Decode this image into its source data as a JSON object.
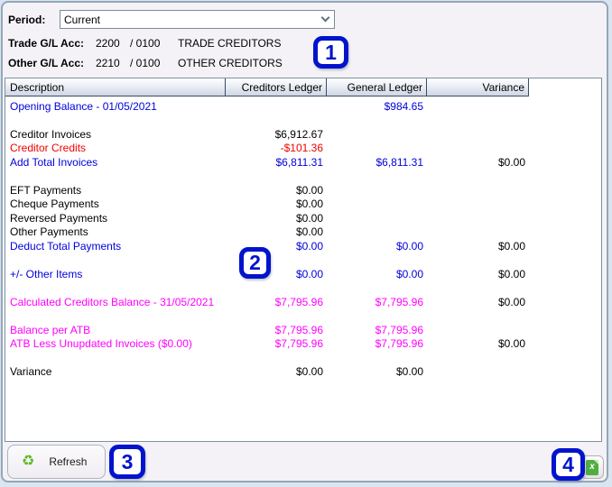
{
  "period": {
    "label": "Period:",
    "value": "Current"
  },
  "accounts": [
    {
      "label": "Trade G/L Acc:",
      "code": "2200",
      "sub": "/ 0100",
      "name": "TRADE CREDITORS"
    },
    {
      "label": "Other G/L Acc:",
      "code": "2210",
      "sub": "/ 0100",
      "name": "OTHER CREDITORS"
    }
  ],
  "table": {
    "columns": [
      "Description",
      "Creditors Ledger",
      "General Ledger",
      "Variance"
    ],
    "rows": [
      {
        "label": "Opening Balance - 01/05/2021",
        "color": "blue",
        "cl": "",
        "gl": "$984.65",
        "va": "",
        "gap": false
      },
      {
        "label": "Creditor Invoices",
        "color": "black",
        "cl": "$6,912.67",
        "gl": "",
        "va": "",
        "gap": true
      },
      {
        "label": "Creditor Credits",
        "color": "red",
        "cl": "-$101.36",
        "gl": "",
        "va": "",
        "gap": false
      },
      {
        "label": "Add Total Invoices",
        "color": "blue",
        "cl": "$6,811.31",
        "gl": "$6,811.31",
        "va": "$0.00",
        "gap": false
      },
      {
        "label": "EFT Payments",
        "color": "black",
        "cl": "$0.00",
        "gl": "",
        "va": "",
        "gap": true
      },
      {
        "label": "Cheque Payments",
        "color": "black",
        "cl": "$0.00",
        "gl": "",
        "va": "",
        "gap": false
      },
      {
        "label": "Reversed Payments",
        "color": "black",
        "cl": "$0.00",
        "gl": "",
        "va": "",
        "gap": false
      },
      {
        "label": "Other Payments",
        "color": "black",
        "cl": "$0.00",
        "gl": "",
        "va": "",
        "gap": false
      },
      {
        "label": "Deduct Total Payments",
        "color": "blue",
        "cl": "$0.00",
        "gl": "$0.00",
        "va": "$0.00",
        "gap": false
      },
      {
        "label": "+/- Other Items",
        "color": "blue",
        "cl": "$0.00",
        "gl": "$0.00",
        "va": "$0.00",
        "gap": true
      },
      {
        "label": "Calculated Creditors Balance - 31/05/2021",
        "color": "magenta",
        "cl": "$7,795.96",
        "gl": "$7,795.96",
        "va": "$0.00",
        "gap": true
      },
      {
        "label": "Balance per ATB",
        "color": "magenta",
        "cl": "$7,795.96",
        "gl": "$7,795.96",
        "va": "",
        "gap": true
      },
      {
        "label": "ATB Less Unupdated Invoices ($0.00)",
        "color": "magenta",
        "cl": "$7,795.96",
        "gl": "$7,795.96",
        "va": "$0.00",
        "gap": false
      },
      {
        "label": "Variance",
        "color": "black",
        "cl": "$0.00",
        "gl": "$0.00",
        "va": "",
        "gap": true
      }
    ]
  },
  "footer": {
    "refresh_label": "Refresh",
    "refresh_icon": "recycle-icon",
    "refresh_icon_glyph": "♻",
    "export_icon": "excel-export-icon",
    "export_icon_glyph": "x"
  },
  "annotations": [
    {
      "label": "1"
    },
    {
      "label": "2"
    },
    {
      "label": "3"
    },
    {
      "label": "4"
    }
  ],
  "colors": {
    "annotation_blue": "#0113cc",
    "row_blue": "#0000dd",
    "row_red": "#f00000",
    "row_magenta": "#ff00ff",
    "window_border": "#93a7b7",
    "window_background": "#f4f2f6",
    "header_gradient_end": "#cfd6e4",
    "excel_green": "#4fae3f",
    "recycle_green": "#5cb820"
  }
}
